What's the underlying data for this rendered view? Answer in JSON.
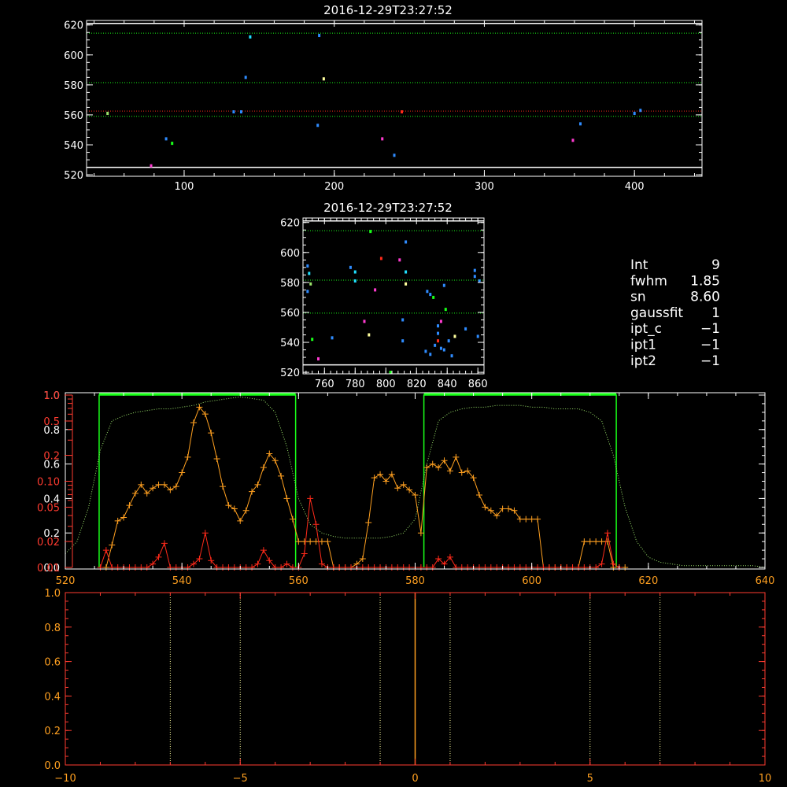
{
  "colors": {
    "background": "#000000",
    "axis": "#ffffff",
    "axis_red": "#ff3b30",
    "orange": "#ffa020",
    "red": "#ff2a1a",
    "green": "#19ff19",
    "light_green": "#9be36b",
    "pale_yellow": "#ffff9e",
    "blue": "#2f8cff",
    "cyan": "#20e0ff",
    "magenta": "#ff3bd1"
  },
  "info_panel": [
    {
      "label": "Int",
      "value": "9"
    },
    {
      "label": "fwhm",
      "value": "1.85"
    },
    {
      "label": "sn",
      "value": "8.60"
    },
    {
      "label": "gaussfit",
      "value": "1"
    },
    {
      "label": "ipt_c",
      "value": "−1"
    },
    {
      "label": "ipt1",
      "value": "−1"
    },
    {
      "label": "ipt2",
      "value": "−1"
    }
  ],
  "chart_data": [
    {
      "id": "top",
      "type": "scatter",
      "title": "2016-12-29T23:27:52",
      "xlim": [
        35,
        445
      ],
      "ylim": [
        519,
        623
      ],
      "xticks": [
        100,
        200,
        300,
        400
      ],
      "yticks": [
        520,
        540,
        560,
        580,
        600,
        620
      ],
      "x_tick_labels": [
        "100",
        "200",
        "300",
        "400"
      ],
      "y_tick_labels": [
        "520",
        "540",
        "560",
        "580",
        "600",
        "620"
      ],
      "hlines": [
        {
          "y": 614.5,
          "color": "green",
          "style": "dotted"
        },
        {
          "y": 581.5,
          "color": "green",
          "style": "dotted"
        },
        {
          "y": 562.5,
          "color": "red",
          "style": "dotted"
        },
        {
          "y": 559,
          "color": "green",
          "style": "dotted"
        },
        {
          "y": 525,
          "color": "axis",
          "style": "solid"
        },
        {
          "y": 621,
          "color": "axis",
          "style": "solid"
        }
      ],
      "points": [
        {
          "x": 49,
          "y": 561,
          "c": "light_green"
        },
        {
          "x": 78,
          "y": 526,
          "c": "magenta"
        },
        {
          "x": 88,
          "y": 544,
          "c": "blue"
        },
        {
          "x": 92,
          "y": 541,
          "c": "green"
        },
        {
          "x": 133,
          "y": 562,
          "c": "blue"
        },
        {
          "x": 138,
          "y": 562,
          "c": "blue"
        },
        {
          "x": 141,
          "y": 585,
          "c": "blue"
        },
        {
          "x": 144,
          "y": 612,
          "c": "cyan"
        },
        {
          "x": 189,
          "y": 553,
          "c": "blue"
        },
        {
          "x": 190,
          "y": 613,
          "c": "blue"
        },
        {
          "x": 193,
          "y": 584,
          "c": "pale_yellow"
        },
        {
          "x": 232,
          "y": 544,
          "c": "magenta"
        },
        {
          "x": 240,
          "y": 533,
          "c": "blue"
        },
        {
          "x": 245,
          "y": 562,
          "c": "red"
        },
        {
          "x": 359,
          "y": 543,
          "c": "magenta"
        },
        {
          "x": 364,
          "y": 554,
          "c": "blue"
        },
        {
          "x": 400,
          "y": 561,
          "c": "blue"
        },
        {
          "x": 404,
          "y": 563,
          "c": "blue"
        }
      ]
    },
    {
      "id": "middle",
      "type": "scatter",
      "title": "2016-12-29T23:27:52",
      "xlim": [
        746,
        864
      ],
      "ylim": [
        519,
        623
      ],
      "xticks": [
        760,
        780,
        800,
        820,
        840,
        860
      ],
      "yticks": [
        520,
        540,
        560,
        580,
        600,
        620
      ],
      "x_tick_labels": [
        "760",
        "780",
        "800",
        "820",
        "840",
        "860"
      ],
      "y_tick_labels": [
        "520",
        "540",
        "560",
        "580",
        "600",
        "620"
      ],
      "hlines": [
        {
          "y": 614.5,
          "color": "green",
          "style": "dotted"
        },
        {
          "y": 581.5,
          "color": "green",
          "style": "dotted"
        },
        {
          "y": 559.5,
          "color": "green",
          "style": "dotted"
        },
        {
          "y": 525,
          "color": "axis",
          "style": "solid"
        },
        {
          "y": 621,
          "color": "axis",
          "style": "solid"
        }
      ],
      "points": [
        {
          "x": 749,
          "y": 591,
          "c": "blue"
        },
        {
          "x": 749,
          "y": 574,
          "c": "blue"
        },
        {
          "x": 750,
          "y": 586,
          "c": "cyan"
        },
        {
          "x": 751,
          "y": 579,
          "c": "light_green"
        },
        {
          "x": 752,
          "y": 542,
          "c": "green"
        },
        {
          "x": 756,
          "y": 529,
          "c": "magenta"
        },
        {
          "x": 765,
          "y": 543,
          "c": "blue"
        },
        {
          "x": 777,
          "y": 590,
          "c": "blue"
        },
        {
          "x": 780,
          "y": 587,
          "c": "cyan"
        },
        {
          "x": 780,
          "y": 581,
          "c": "cyan"
        },
        {
          "x": 786,
          "y": 554,
          "c": "magenta"
        },
        {
          "x": 790,
          "y": 614,
          "c": "green"
        },
        {
          "x": 789,
          "y": 545,
          "c": "pale_yellow"
        },
        {
          "x": 793,
          "y": 575,
          "c": "magenta"
        },
        {
          "x": 797,
          "y": 596,
          "c": "red"
        },
        {
          "x": 803,
          "y": 520,
          "c": "green"
        },
        {
          "x": 809,
          "y": 595,
          "c": "magenta"
        },
        {
          "x": 811,
          "y": 555,
          "c": "blue"
        },
        {
          "x": 811,
          "y": 541,
          "c": "blue"
        },
        {
          "x": 813,
          "y": 607,
          "c": "blue"
        },
        {
          "x": 813,
          "y": 587,
          "c": "cyan"
        },
        {
          "x": 813,
          "y": 579,
          "c": "pale_yellow"
        },
        {
          "x": 827,
          "y": 574,
          "c": "blue"
        },
        {
          "x": 829,
          "y": 572,
          "c": "blue"
        },
        {
          "x": 831,
          "y": 570,
          "c": "green"
        },
        {
          "x": 826,
          "y": 534,
          "c": "blue"
        },
        {
          "x": 829,
          "y": 532,
          "c": "blue"
        },
        {
          "x": 832,
          "y": 538,
          "c": "blue"
        },
        {
          "x": 834,
          "y": 546,
          "c": "blue"
        },
        {
          "x": 834,
          "y": 551,
          "c": "blue"
        },
        {
          "x": 836,
          "y": 554,
          "c": "magenta"
        },
        {
          "x": 834,
          "y": 541,
          "c": "red"
        },
        {
          "x": 836,
          "y": 536,
          "c": "blue"
        },
        {
          "x": 838,
          "y": 535,
          "c": "blue"
        },
        {
          "x": 838,
          "y": 578,
          "c": "blue"
        },
        {
          "x": 839,
          "y": 562,
          "c": "green"
        },
        {
          "x": 841,
          "y": 541,
          "c": "blue"
        },
        {
          "x": 843,
          "y": 531,
          "c": "blue"
        },
        {
          "x": 845,
          "y": 544,
          "c": "pale_yellow"
        },
        {
          "x": 852,
          "y": 549,
          "c": "blue"
        },
        {
          "x": 858,
          "y": 588,
          "c": "blue"
        },
        {
          "x": 858,
          "y": 584,
          "c": "blue"
        },
        {
          "x": 860,
          "y": 544,
          "c": "blue"
        },
        {
          "x": 861,
          "y": 581,
          "c": "blue"
        }
      ]
    },
    {
      "id": "spectrum",
      "type": "line",
      "xlim": [
        520,
        640
      ],
      "x_ticks_major": [
        520,
        540,
        560,
        580,
        600,
        620,
        640
      ],
      "x_tick_labels": [
        "520",
        "540",
        "560",
        "580",
        "600",
        "620",
        "640"
      ],
      "left_axis_white": {
        "ylim": [
          0,
          1.0
        ],
        "ticks": [
          0.0,
          0.2,
          0.4,
          0.6,
          0.8,
          1.0
        ],
        "labels": [
          "0.0",
          "0.2",
          "0.4",
          "0.6",
          "0.8",
          "1.0"
        ]
      },
      "left_axis_red": {
        "type": "log",
        "ticks": [
          0.01,
          0.02,
          0.05,
          0.1,
          0.2,
          0.5,
          1.0
        ],
        "labels": [
          "0.01",
          "0.02",
          "0.05",
          "0.10",
          "0.2",
          "0.5",
          "1.0"
        ]
      },
      "green_boxes": [
        {
          "x0": 525.8,
          "x1": 559.5,
          "top": 1.0
        },
        {
          "x0": 581.5,
          "x1": 614.5,
          "top": 1.0
        }
      ],
      "filter_curve": {
        "style": "dotted",
        "color": "light_green",
        "x": [
          520,
          522,
          524,
          526,
          528,
          530,
          532,
          534,
          536,
          538,
          540,
          542,
          544,
          546,
          548,
          550,
          552,
          554,
          556,
          558,
          560,
          562,
          564,
          566,
          568,
          570,
          572,
          574,
          576,
          578,
          580,
          582,
          584,
          586,
          588,
          590,
          592,
          594,
          596,
          598,
          600,
          602,
          604,
          606,
          608,
          610,
          612,
          614,
          616,
          618,
          620,
          622,
          624,
          626,
          628,
          630,
          632,
          634,
          636,
          638,
          640
        ],
        "y": [
          0.08,
          0.15,
          0.35,
          0.68,
          0.85,
          0.88,
          0.9,
          0.91,
          0.92,
          0.92,
          0.93,
          0.94,
          0.96,
          0.97,
          0.98,
          0.99,
          0.98,
          0.97,
          0.9,
          0.7,
          0.4,
          0.25,
          0.2,
          0.18,
          0.17,
          0.17,
          0.17,
          0.17,
          0.18,
          0.2,
          0.28,
          0.6,
          0.85,
          0.9,
          0.92,
          0.93,
          0.93,
          0.94,
          0.94,
          0.94,
          0.93,
          0.93,
          0.92,
          0.92,
          0.92,
          0.9,
          0.85,
          0.65,
          0.35,
          0.15,
          0.06,
          0.03,
          0.02,
          0.01,
          0.01,
          0.01,
          0.01,
          0.01,
          0.01,
          0.01,
          0.0
        ]
      },
      "orange_series": {
        "x": [
          527,
          528,
          529,
          530,
          531,
          532,
          533,
          534,
          535,
          536,
          537,
          538,
          539,
          540,
          541,
          542,
          543,
          544,
          545,
          546,
          547,
          548,
          549,
          550,
          551,
          552,
          553,
          554,
          555,
          556,
          557,
          558,
          559,
          560,
          561,
          562,
          563,
          564,
          565,
          566,
          567,
          568,
          569,
          570,
          571,
          572,
          573,
          574,
          575,
          576,
          577,
          578,
          579,
          580,
          581,
          582,
          583,
          584,
          585,
          586,
          587,
          588,
          589,
          590,
          591,
          592,
          593,
          594,
          595,
          596,
          597,
          598,
          599,
          600,
          601,
          602,
          603,
          604,
          605,
          606,
          607,
          608,
          609,
          610,
          611,
          612,
          613,
          614,
          615,
          616
        ],
        "y": [
          0.0,
          0.13,
          0.27,
          0.29,
          0.36,
          0.43,
          0.48,
          0.43,
          0.46,
          0.48,
          0.48,
          0.45,
          0.47,
          0.55,
          0.64,
          0.84,
          0.93,
          0.89,
          0.78,
          0.63,
          0.47,
          0.36,
          0.34,
          0.27,
          0.33,
          0.44,
          0.48,
          0.58,
          0.66,
          0.62,
          0.53,
          0.4,
          0.28,
          0.15,
          0.15,
          0.15,
          0.15,
          0.15,
          0.15,
          0.0,
          0.0,
          0.0,
          0.0,
          0.02,
          0.05,
          0.26,
          0.52,
          0.54,
          0.5,
          0.54,
          0.46,
          0.48,
          0.45,
          0.42,
          0.2,
          0.58,
          0.6,
          0.58,
          0.62,
          0.56,
          0.64,
          0.55,
          0.56,
          0.52,
          0.42,
          0.35,
          0.33,
          0.3,
          0.34,
          0.34,
          0.33,
          0.28,
          0.28,
          0.28,
          0.28,
          0.0,
          0.0,
          0.0,
          0.0,
          0.0,
          0.0,
          0.0,
          0.15,
          0.15,
          0.15,
          0.15,
          0.15,
          0.0,
          0.0,
          0.0
        ]
      },
      "red_series": {
        "x": [
          526,
          527,
          528,
          529,
          530,
          531,
          532,
          533,
          534,
          535,
          536,
          537,
          538,
          539,
          540,
          541,
          542,
          543,
          544,
          545,
          546,
          547,
          548,
          549,
          550,
          551,
          552,
          553,
          554,
          555,
          556,
          557,
          558,
          559,
          560,
          561,
          562,
          563,
          564,
          565,
          566,
          567,
          568,
          569,
          570,
          571,
          572,
          573,
          574,
          575,
          576,
          577,
          578,
          579,
          580,
          581,
          582,
          583,
          584,
          585,
          586,
          587,
          588,
          589,
          590,
          591,
          592,
          593,
          594,
          595,
          596,
          597,
          598,
          599,
          600,
          601,
          602,
          603,
          604,
          605,
          606,
          607,
          608,
          609,
          610,
          611,
          612,
          613,
          614,
          615
        ],
        "y": [
          0.0,
          0.1,
          0.0,
          0.0,
          0.0,
          0.0,
          0.0,
          0.0,
          0.0,
          0.02,
          0.06,
          0.14,
          0.0,
          0.0,
          0.0,
          0.0,
          0.02,
          0.05,
          0.2,
          0.04,
          0.0,
          0.0,
          0.0,
          0.0,
          0.0,
          0.0,
          0.0,
          0.02,
          0.1,
          0.04,
          0.0,
          0.0,
          0.02,
          0.0,
          0.0,
          0.08,
          0.4,
          0.25,
          0.02,
          0.0,
          0.0,
          0.0,
          0.0,
          0.0,
          0.0,
          0.0,
          0.0,
          0.0,
          0.0,
          0.0,
          0.0,
          0.0,
          0.0,
          0.0,
          0.0,
          0.0,
          0.0,
          0.0,
          0.05,
          0.02,
          0.06,
          0.0,
          0.0,
          0.0,
          0.0,
          0.0,
          0.0,
          0.0,
          0.0,
          0.0,
          0.0,
          0.0,
          0.0,
          0.0,
          0.0,
          0.0,
          0.0,
          0.0,
          0.0,
          0.0,
          0.0,
          0.0,
          0.0,
          0.0,
          0.0,
          0.0,
          0.02,
          0.2,
          0.02,
          0.0
        ]
      }
    },
    {
      "id": "bottom",
      "type": "line",
      "xlim": [
        -10,
        10
      ],
      "ylim": [
        0,
        1.0
      ],
      "xticks": [
        -10,
        -5,
        0,
        5,
        10
      ],
      "yticks": [
        0.0,
        0.2,
        0.4,
        0.6,
        0.8,
        1.0
      ],
      "x_tick_labels": [
        "−10",
        "−5",
        "0",
        "5",
        "10"
      ],
      "y_tick_labels": [
        "0.0",
        "0.2",
        "0.4",
        "0.6",
        "0.8",
        "1.0"
      ],
      "vlines_dotted": [
        -7,
        -5,
        -1,
        1,
        5,
        7
      ],
      "vline_solid": 0
    }
  ]
}
